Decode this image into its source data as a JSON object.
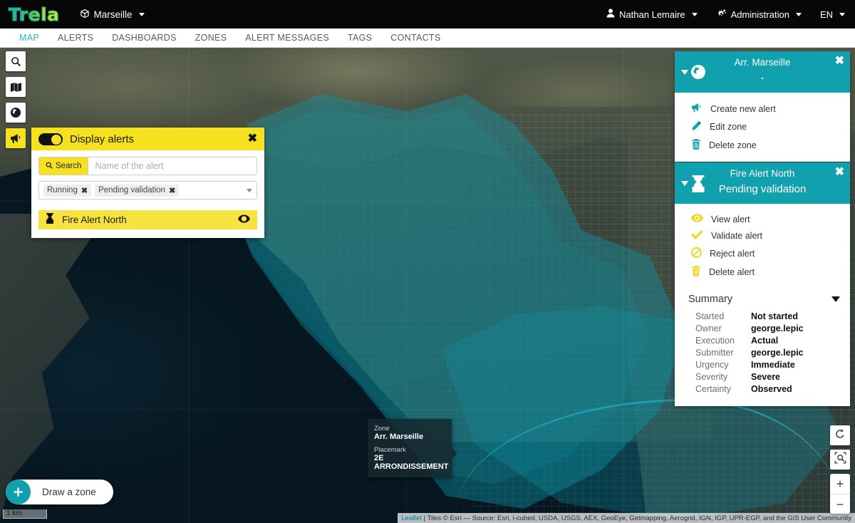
{
  "topbar": {
    "logo": "Trela",
    "org": {
      "label": "Marseille",
      "icon": "cube-icon"
    },
    "user": {
      "label": "Nathan Lemaire",
      "icon": "user-icon"
    },
    "admin": {
      "label": "Administration",
      "icon": "gears-icon"
    },
    "language": {
      "label": "EN"
    }
  },
  "nav": {
    "items": [
      {
        "label": "MAP",
        "active": true
      },
      {
        "label": "ALERTS",
        "active": false
      },
      {
        "label": "DASHBOARDS",
        "active": false
      },
      {
        "label": "ZONES",
        "active": false
      },
      {
        "label": "ALERT MESSAGES",
        "active": false
      },
      {
        "label": "TAGS",
        "active": false
      },
      {
        "label": "CONTACTS",
        "active": false
      }
    ]
  },
  "left_toolbar": {
    "buttons": [
      {
        "name": "search-tool",
        "icon": "search-icon",
        "active": false
      },
      {
        "name": "layers-tool",
        "icon": "map-layers-icon",
        "active": false
      },
      {
        "name": "globe-tool",
        "icon": "globe-icon",
        "active": false
      },
      {
        "name": "alerts-tool",
        "icon": "megaphone-icon",
        "active": true
      }
    ]
  },
  "alerts_panel": {
    "title": "Display alerts",
    "toggle_on": true,
    "close_label": "✖",
    "search_button": "Search",
    "search_value": "",
    "search_placeholder": "Name of the alert",
    "filter_chips": [
      {
        "label": "Running",
        "remove": "✖"
      },
      {
        "label": "Pending validation",
        "remove": "✖"
      }
    ],
    "results": [
      {
        "label": "Fire Alert North",
        "status_icon": "hourglass-icon",
        "visibility_icon": "eye-icon"
      }
    ]
  },
  "zone_panel": {
    "title": "Arr. Marseille",
    "subtitle": "-",
    "header_icon": "globe-icon",
    "close_label": "✖",
    "actions": [
      {
        "label": "Create new alert",
        "icon": "megaphone-icon"
      },
      {
        "label": "Edit zone",
        "icon": "pencil-icon"
      },
      {
        "label": "Delete zone",
        "icon": "trash-icon"
      }
    ]
  },
  "alert_panel": {
    "title": "Fire Alert North",
    "subtitle": "Pending validation",
    "header_icon": "hourglass-icon",
    "close_label": "✖",
    "actions": [
      {
        "label": "View alert",
        "icon": "eye-icon"
      },
      {
        "label": "Validate alert",
        "icon": "check-icon"
      },
      {
        "label": "Reject alert",
        "icon": "ban-icon"
      },
      {
        "label": "Delete alert",
        "icon": "trash-icon"
      }
    ],
    "summary": {
      "heading": "Summary",
      "rows": [
        {
          "key": "Started",
          "value": "Not started"
        },
        {
          "key": "Owner",
          "value": "george.lepic"
        },
        {
          "key": "Execution",
          "value": "Actual"
        },
        {
          "key": "Submitter",
          "value": "george.lepic"
        },
        {
          "key": "Urgency",
          "value": "Immediate"
        },
        {
          "key": "Severity",
          "value": "Severe"
        },
        {
          "key": "Certainty",
          "value": "Observed"
        }
      ]
    }
  },
  "map_tooltip": {
    "zone_key": "Zone",
    "zone_value": "Arr. Marseille",
    "placemark_key": "Placemark",
    "placemark_value": "2E ARRONDISSEMENT"
  },
  "draw_zone": {
    "label": "Draw a zone",
    "icon": "plus-icon"
  },
  "scalebar": {
    "label": "1 km"
  },
  "map_controls": [
    {
      "name": "reset-view-button",
      "icon": "undo-icon"
    },
    {
      "name": "zoom-to-area-button",
      "icon": "zoom-area-icon"
    },
    {
      "name": "zoom-in-button",
      "icon": "plus-icon",
      "label": "+"
    },
    {
      "name": "zoom-out-button",
      "icon": "minus-icon",
      "label": "−"
    }
  ],
  "attribution": {
    "leaflet": "Leaflet",
    "text": " | Tiles © Esri — Source: Esri, i-cubed, USDA, USGS, AEX, GeoEye, Getmapping, Aerogrid, IGN, IGP, UPR-EGP, and the GIS User Community"
  },
  "colors": {
    "accent_teal": "#11a0ae",
    "accent_yellow": "#f5e11e",
    "topbar_black": "#070707",
    "nav_active": "#2bb6c4"
  }
}
